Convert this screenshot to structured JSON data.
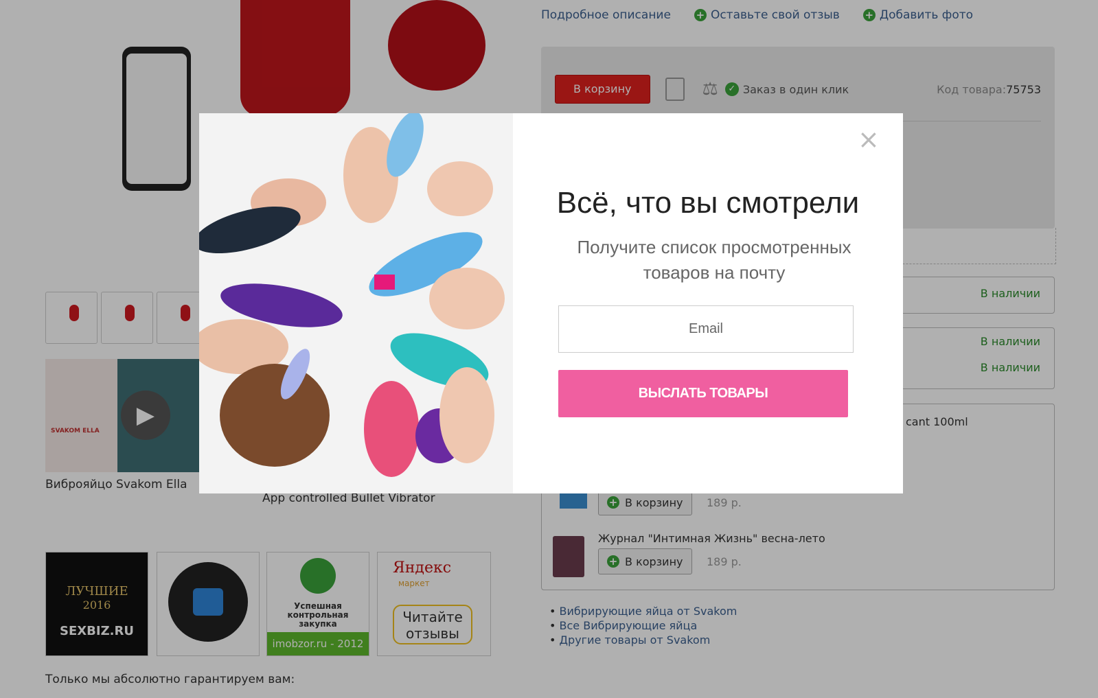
{
  "tabs": {
    "description": "Подробное описание",
    "review": "Оставьте свой отзыв",
    "add_photo": "Добавить фото"
  },
  "cart_panel": {
    "cart_button": "В корзину",
    "one_click": "Заказ в один клик",
    "code_label": "Код товара:",
    "code_value": "75753"
  },
  "stock": {
    "available_1": "В наличии",
    "available_2": "В наличии",
    "available_3": "В наличии"
  },
  "products": {
    "item1_title": "cant 100ml",
    "item2_cart": "В корзину",
    "item2_price": "189 р.",
    "item3_title": "Журнал \"Интимная Жизнь\" весна-лето",
    "item3_cart": "В корзину",
    "item3_price": "189 р."
  },
  "links": [
    "Вибрирующие яйца от Svakom",
    "Все Вибрирующие яйца",
    "Другие товары от Svakom"
  ],
  "left": {
    "caption1": "Виброяйцо Svakom Ella",
    "caption2": "App controlled Bullet Vibrator",
    "video_label": "SVAKOM ELLA",
    "guarantee": "Только мы абсолютно гарантируем вам:"
  },
  "badges": {
    "b1_line1": "ЛУЧШИЕ",
    "b1_line2": "2016",
    "b1_line3": "SEXBIZ.RU",
    "b3_text": "Успешная контрольная закупка",
    "b3_bar": "imobzor.ru - 2012",
    "b4_brand": "Яндекс",
    "b4_sub": "маркет",
    "b4_read": "Читайте отзывы"
  },
  "modal": {
    "title": "Всё, что вы смотрели",
    "subtitle": "Получите список просмотренных товаров на почту",
    "email_placeholder": "Email",
    "send_label": "ВЫСЛАТЬ ТОВАРЫ"
  },
  "colors": {
    "accent_pink": "#f05fa0",
    "cart_red": "#e0201e",
    "available_green": "#2a8a2a"
  }
}
